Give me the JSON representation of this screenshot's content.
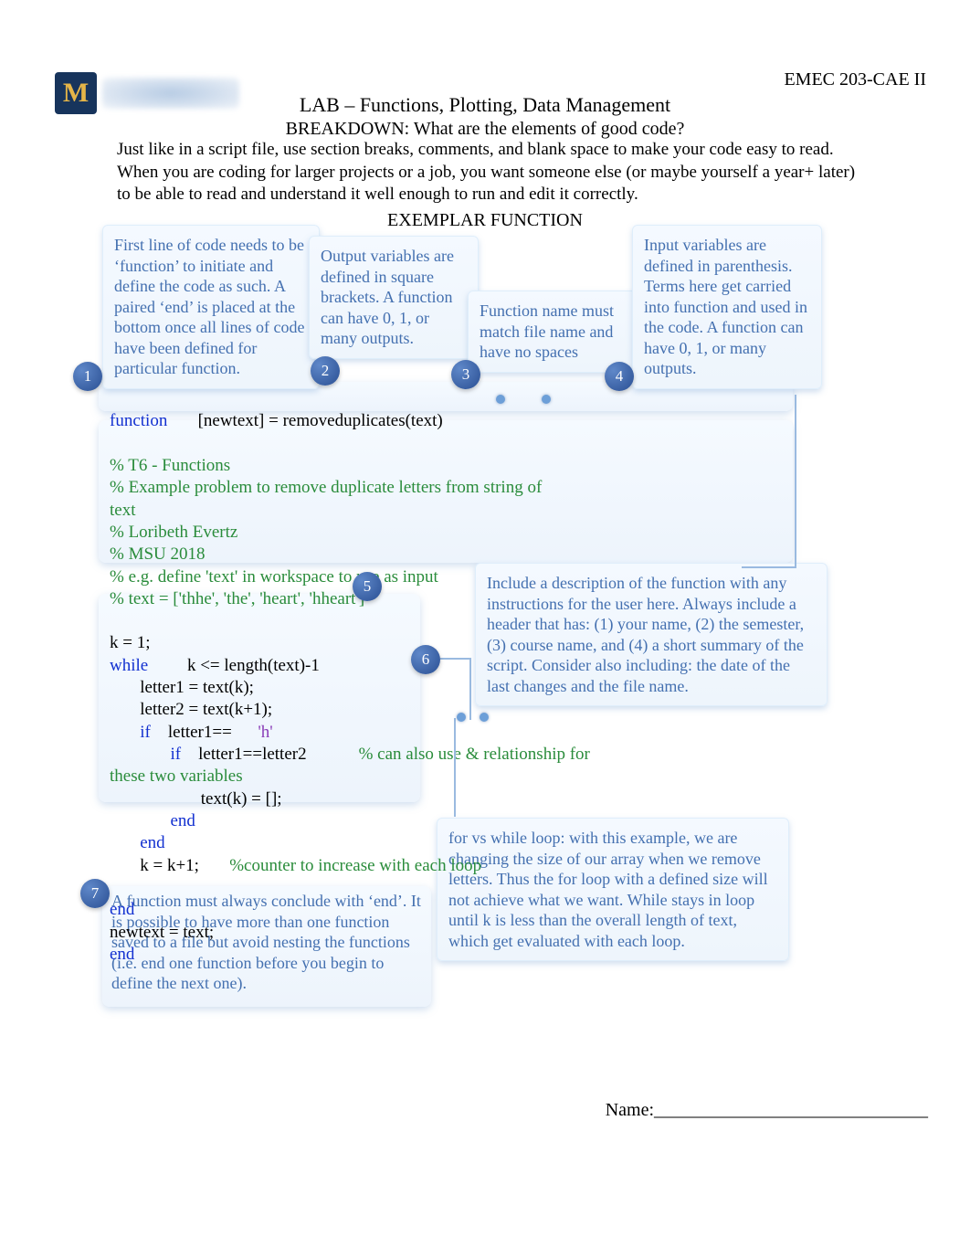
{
  "header": {
    "course": "EMEC 203-CAE II",
    "title": "LAB – Functions, Plotting, Data Management",
    "subtitle": "BREAKDOWN: What are the elements of good code?"
  },
  "intro": "Just like in a script file, use section breaks, comments, and blank space to make your code easy to read. When you are coding for larger projects or a job, you want someone else (or maybe yourself a year+ later) to be able to read and understand it well enough to run and edit it correctly.",
  "exemplar_title": "EXEMPLAR FUNCTION",
  "callouts": {
    "c1": "First line of code needs to be ‘function’ to initiate and define the code as such. A paired ‘end’ is placed at the bottom once all lines of code have been defined for particular function.",
    "c2": "Output variables are defined in square brackets. A function can have 0, 1, or many outputs.",
    "c3": "Function name must match file name and have no spaces",
    "c4": "Input variables are defined in parenthesis. Terms here get carried into function and used in the code. A function can have 0, 1, or many outputs.",
    "c5": "Include a description of the function with any instructions for the user here. Always include a header that has: (1) your name, (2) the semester, (3) course name, and (4) a short summary of the script. Consider also including: the date of the last changes and the file name.",
    "c6": " for vs while loop: with this example, we are changing the size of our array when we remove letters. Thus the for loop with a defined size will not achieve what we want. While stays in loop until k is less than the overall length of text, which get evaluated with each loop.",
    "c7": "A function must always conclude with ‘end’. It is possible to have more than one function saved to a file but avoid nesting the functions (i.e. end one function before you begin to define the next one)."
  },
  "badges": {
    "b1": "1",
    "b2": "2",
    "b3": "3",
    "b4": "4",
    "b5": "5",
    "b6": "6",
    "b7": "7"
  },
  "code": {
    "fn_kw": "function",
    "fn_sig": "[newtext] = removeduplicates(text)",
    "cmt1": "% T6 - Functions",
    "cmt2": "% Example problem to remove duplicate letters from string of",
    "cmt2b": "text",
    "cmt3": "% Loribeth Evertz",
    "cmt4": "% MSU 2018",
    "cmt5": "% e.g. define 'text' in workspace to use as input",
    "cmt6": "% text = ['thhe', 'the', 'heart', 'hheart']",
    "l_k1": "k = 1;",
    "l_while_kw": "while",
    "l_while_cond": "k <= length(text)-1",
    "l_let1": "letter1 = text(k);",
    "l_let2": "letter2 = text(k+1);",
    "l_if1_kw": "if",
    "l_if1_cond": "letter1==",
    "l_if1_str": "'h'",
    "l_if2_kw": "if",
    "l_if2_cond": "letter1==letter2",
    "l_if2_cmt": "% can also use & relationship for",
    "l_if2_cmt2": "these two variables",
    "l_assign": "text(k) = [];",
    "l_end1": "end",
    "l_end2": "end",
    "l_kinc": "k = k+1;",
    "l_kinc_cmt": "%counter to increase with each loop",
    "l_end3": "end",
    "l_newtext": "newtext = text;",
    "l_end4": "end"
  },
  "footer": {
    "name_label": "Name:______________________________"
  }
}
